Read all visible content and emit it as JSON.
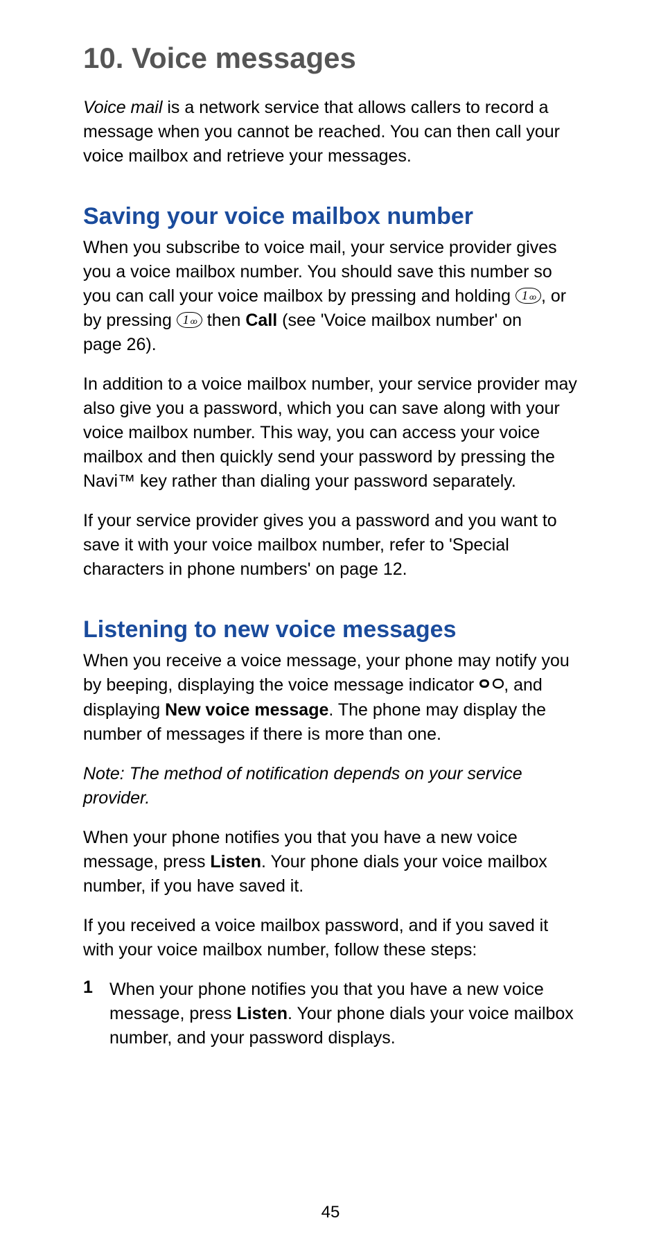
{
  "chapter": {
    "title": "10. Voice messages"
  },
  "intro": {
    "lead_italic": "Voice mail",
    "rest": " is a network service that allows callers to record a message when you cannot be reached. You can then call your voice mailbox and retrieve your messages."
  },
  "section1": {
    "heading": "Saving your voice mailbox number",
    "p1a": "When you subscribe to voice mail, your service provider gives you a voice mailbox number. You should save this number so you can call your voice mailbox by pressing and holding ",
    "p1b": ", or by pressing ",
    "p1c": " then ",
    "p1_bold": "Call",
    "p1d": " (see 'Voice mailbox number' on page 26).",
    "p2": "In addition to a voice mailbox number, your service provider may also give you a password, which you can save along with your voice mailbox number. This way, you can access your voice mailbox and then quickly send your password by pressing the Navi™ key rather than dialing your password separately.",
    "p3": "If your service provider gives you a password and you want to save it with your voice mailbox number, refer to 'Special characters in phone numbers' on page 12."
  },
  "section2": {
    "heading": "Listening to new voice messages",
    "p1a": "When you receive a voice message, your phone may notify you by beeping, displaying the voice message indicator ",
    "p1b": ", and displaying ",
    "p1_bold": "New voice message",
    "p1c": ". The phone may display the number of messages if there is more than one.",
    "note": "Note:  The method of notification depends on your service provider.",
    "p2a": "When your phone notifies you that you have a new voice message, press ",
    "p2_bold": "Listen",
    "p2b": ". Your phone dials your voice mailbox number, if you have saved it.",
    "p3": "If you received a voice mailbox password, and if you saved it with your voice mailbox number, follow these steps:",
    "step1_num": "1",
    "step1a": "When your phone notifies you that you have a new voice message, press ",
    "step1_bold": "Listen",
    "step1b": ". Your phone dials your voice mailbox number, and your password displays."
  },
  "icons": {
    "key1_label": "1",
    "key1_glyph": "1 ꙩꙩ"
  },
  "page_number": "45"
}
